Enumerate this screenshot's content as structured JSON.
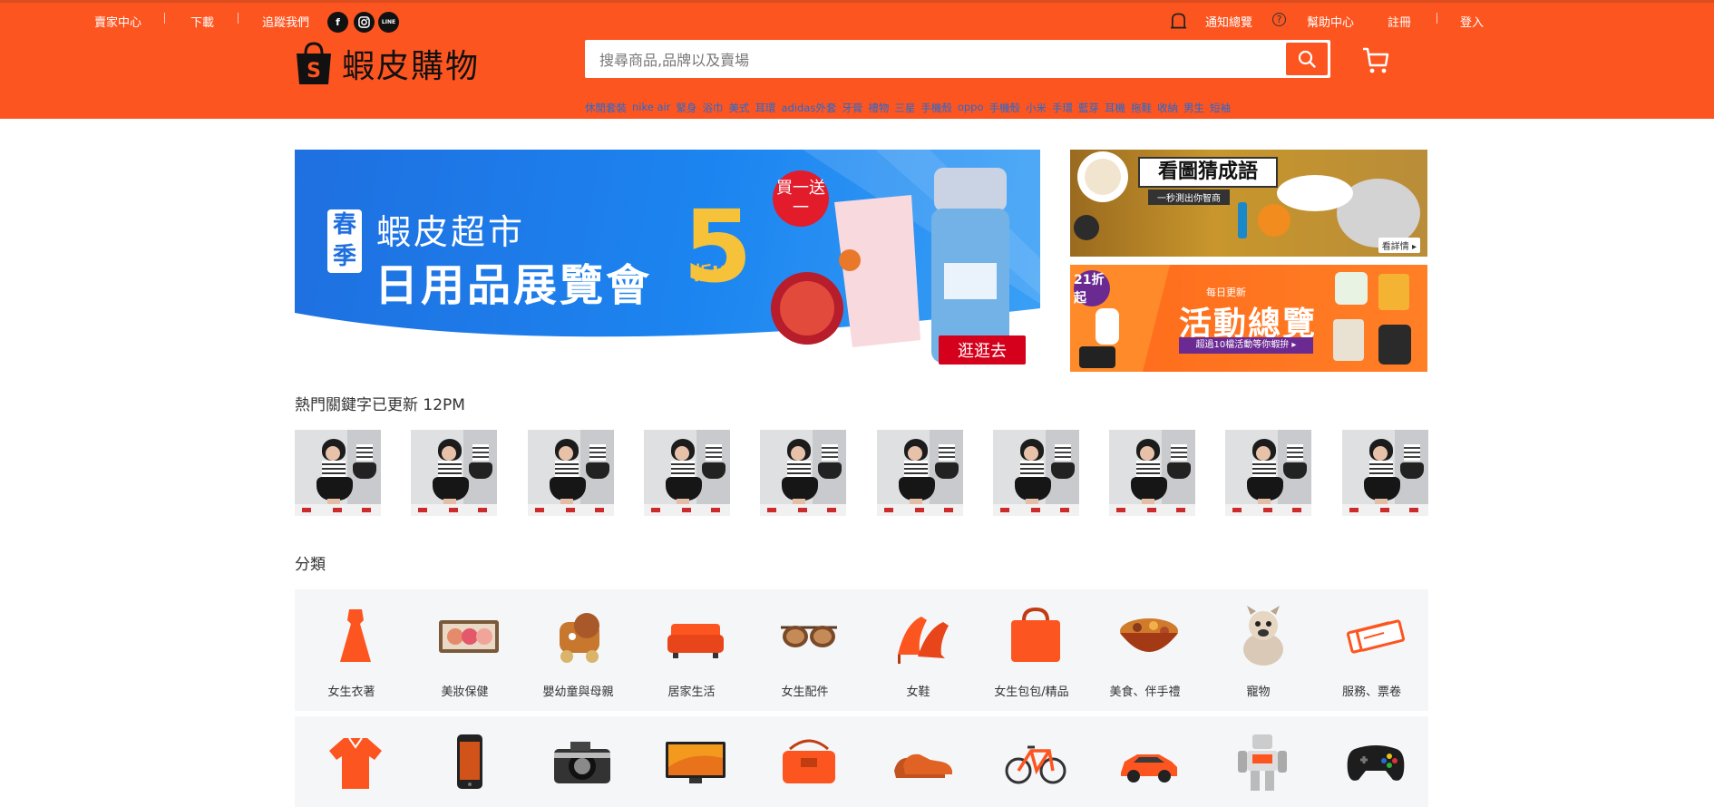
{
  "topbar": {
    "seller_center": "賣家中心",
    "download": "下載",
    "follow_us": "追蹤我們",
    "notifications": "通知總覽",
    "help_center": "幫助中心",
    "register": "註冊",
    "login": "登入",
    "social_facebook": "f",
    "social_line": "LINE"
  },
  "brand": {
    "name": "蝦皮購物",
    "logo_letter": "S"
  },
  "search": {
    "placeholder": "搜尋商品,品牌以及賣場",
    "value": ""
  },
  "hot_search_words": [
    "休閒套裝",
    "nike air",
    "緊身",
    "浴巾",
    "美式",
    "耳環",
    "adidas外套",
    "牙膏",
    "禮物",
    "三星",
    "手機殼",
    "oppo",
    "手機殼",
    "小米",
    "手環",
    "藍芽",
    "耳機",
    "拖鞋",
    "收納",
    "男生",
    "短袖"
  ],
  "main_banner": {
    "tag": "春季",
    "subtitle": "蝦皮超市",
    "title": "日用品展覽會",
    "discount_number": "5",
    "discount_suffix": "折UP",
    "promo": "買一送一",
    "cta": "逛逛去"
  },
  "side_banner_1": {
    "title": "看圖猜成語",
    "subtitle": "一秒測出你智商",
    "more": "看詳情 ▸"
  },
  "side_banner_2": {
    "badge": "21折起",
    "kicker": "每日更新",
    "title": "活動總覽",
    "strip": "超過10檔活動等你蝦拚 ▸"
  },
  "hot_keywords": {
    "title": "熱門關鍵字已更新 12PM",
    "count": 10
  },
  "categories": {
    "title": "分類",
    "row1": [
      {
        "label": "女生衣著",
        "icon": "dress-icon"
      },
      {
        "label": "美妝保健",
        "icon": "makeup-palette-icon"
      },
      {
        "label": "嬰幼童與母親",
        "icon": "toy-train-icon"
      },
      {
        "label": "居家生活",
        "icon": "sofa-icon"
      },
      {
        "label": "女生配件",
        "icon": "sunglasses-icon"
      },
      {
        "label": "女鞋",
        "icon": "high-heels-icon"
      },
      {
        "label": "女生包包/精品",
        "icon": "handbag-icon"
      },
      {
        "label": "美食、伴手禮",
        "icon": "food-bowl-icon"
      },
      {
        "label": "寵物",
        "icon": "dog-icon"
      },
      {
        "label": "服務、票卷",
        "icon": "tickets-icon"
      }
    ],
    "row2_icons": [
      "polo-shirt-icon",
      "smartphone-icon",
      "camera-icon",
      "tv-icon",
      "shoulder-bag-icon",
      "mens-shoes-icon",
      "bicycle-icon",
      "car-icon",
      "robot-toy-icon",
      "game-controller-icon"
    ]
  },
  "colors": {
    "brand_orange": "#fd5520",
    "link_blue": "#1e6bd6",
    "banner_blue": "#1f6fe0"
  }
}
